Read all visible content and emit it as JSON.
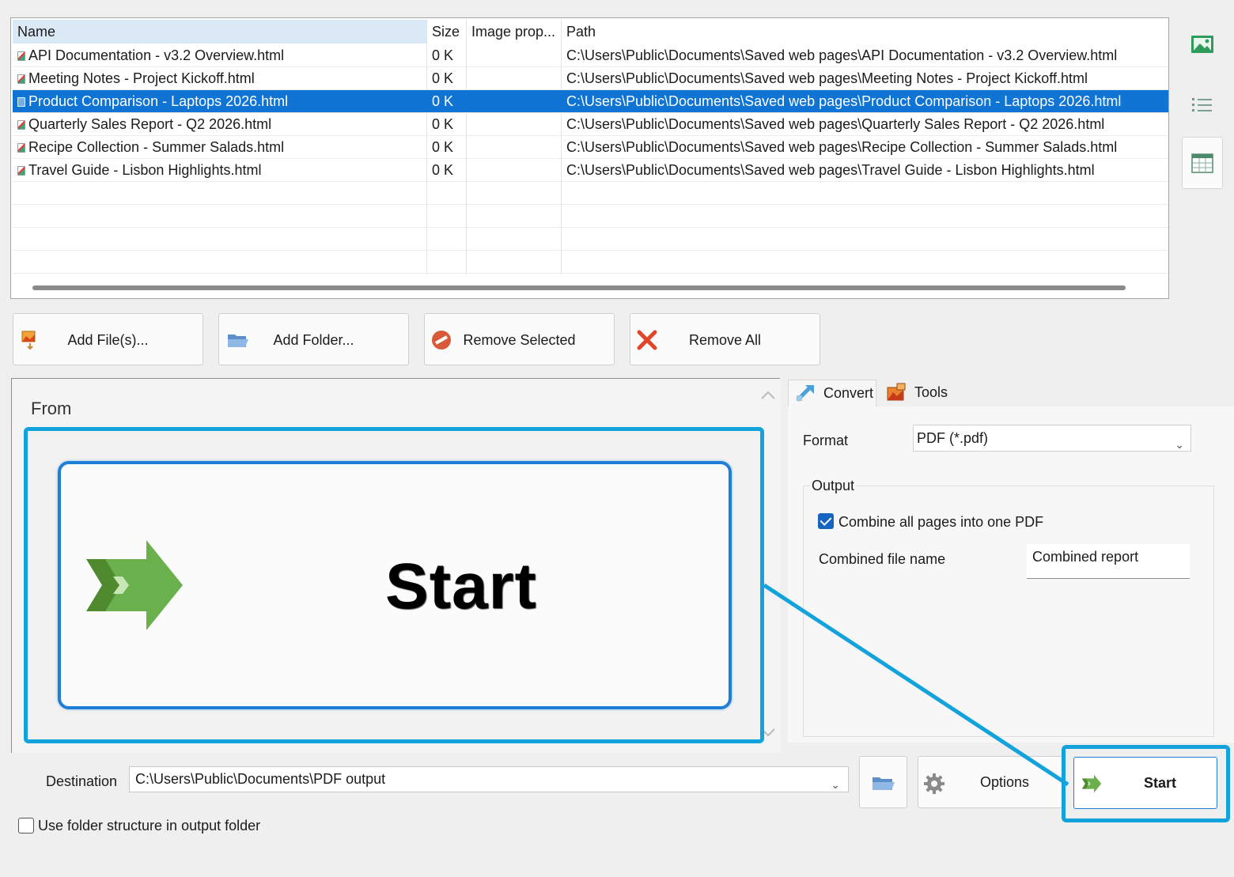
{
  "table": {
    "columns": [
      "Name",
      "Size",
      "Image prop...",
      "Path"
    ],
    "rows": [
      {
        "name": "API Documentation - v3.2 Overview.html",
        "size": "0 K",
        "path": "C:\\Users\\Public\\Documents\\Saved web pages\\API Documentation - v3.2 Overview.html",
        "selected": false
      },
      {
        "name": "Meeting Notes - Project Kickoff.html",
        "size": "0 K",
        "path": "C:\\Users\\Public\\Documents\\Saved web pages\\Meeting Notes - Project Kickoff.html",
        "selected": false
      },
      {
        "name": "Product Comparison - Laptops 2026.html",
        "size": "0 K",
        "path": "C:\\Users\\Public\\Documents\\Saved web pages\\Product Comparison - Laptops 2026.html",
        "selected": true
      },
      {
        "name": "Quarterly Sales Report - Q2 2026.html",
        "size": "0 K",
        "path": "C:\\Users\\Public\\Documents\\Saved web pages\\Quarterly Sales Report - Q2 2026.html",
        "selected": false
      },
      {
        "name": "Recipe Collection - Summer Salads.html",
        "size": "0 K",
        "path": "C:\\Users\\Public\\Documents\\Saved web pages\\Recipe Collection - Summer Salads.html",
        "selected": false
      },
      {
        "name": "Travel Guide - Lisbon Highlights.html",
        "size": "0 K",
        "path": "C:\\Users\\Public\\Documents\\Saved web pages\\Travel Guide - Lisbon Highlights.html",
        "selected": false
      }
    ]
  },
  "toolbar": {
    "add_files": "Add File(s)...",
    "add_folder": "Add Folder...",
    "remove_selected": "Remove Selected",
    "remove_all": "Remove All"
  },
  "from_panel": {
    "title": "From"
  },
  "zoom": {
    "label": "Start"
  },
  "tabs": {
    "convert": "Convert",
    "tools": "Tools"
  },
  "convert": {
    "format_label": "Format",
    "format_value": "PDF (*.pdf)",
    "output_label": "Output",
    "combine_label": "Combine all pages into one PDF",
    "combine_checked": true,
    "combined_name_label": "Combined file name",
    "combined_name_value": "Combined report"
  },
  "bottom": {
    "destination_label": "Destination",
    "destination_value": "C:\\Users\\Public\\Documents\\PDF output",
    "options_label": "Options",
    "start_label": "Start",
    "folder_structure_label": "Use folder structure in output folder",
    "folder_structure_checked": false
  },
  "colors": {
    "selection": "#0f74d4",
    "highlight": "#12a3dc",
    "accent": "#1f7ed6",
    "arrow_green": "#6ab04c"
  },
  "icons": [
    "landscape-view-icon",
    "list-view-icon",
    "table-view-icon",
    "add-files-icon",
    "add-folder-icon",
    "remove-selected-icon",
    "remove-all-icon",
    "convert-icon",
    "tools-icon",
    "browse-folder-icon",
    "gear-icon",
    "start-arrow-icon"
  ]
}
